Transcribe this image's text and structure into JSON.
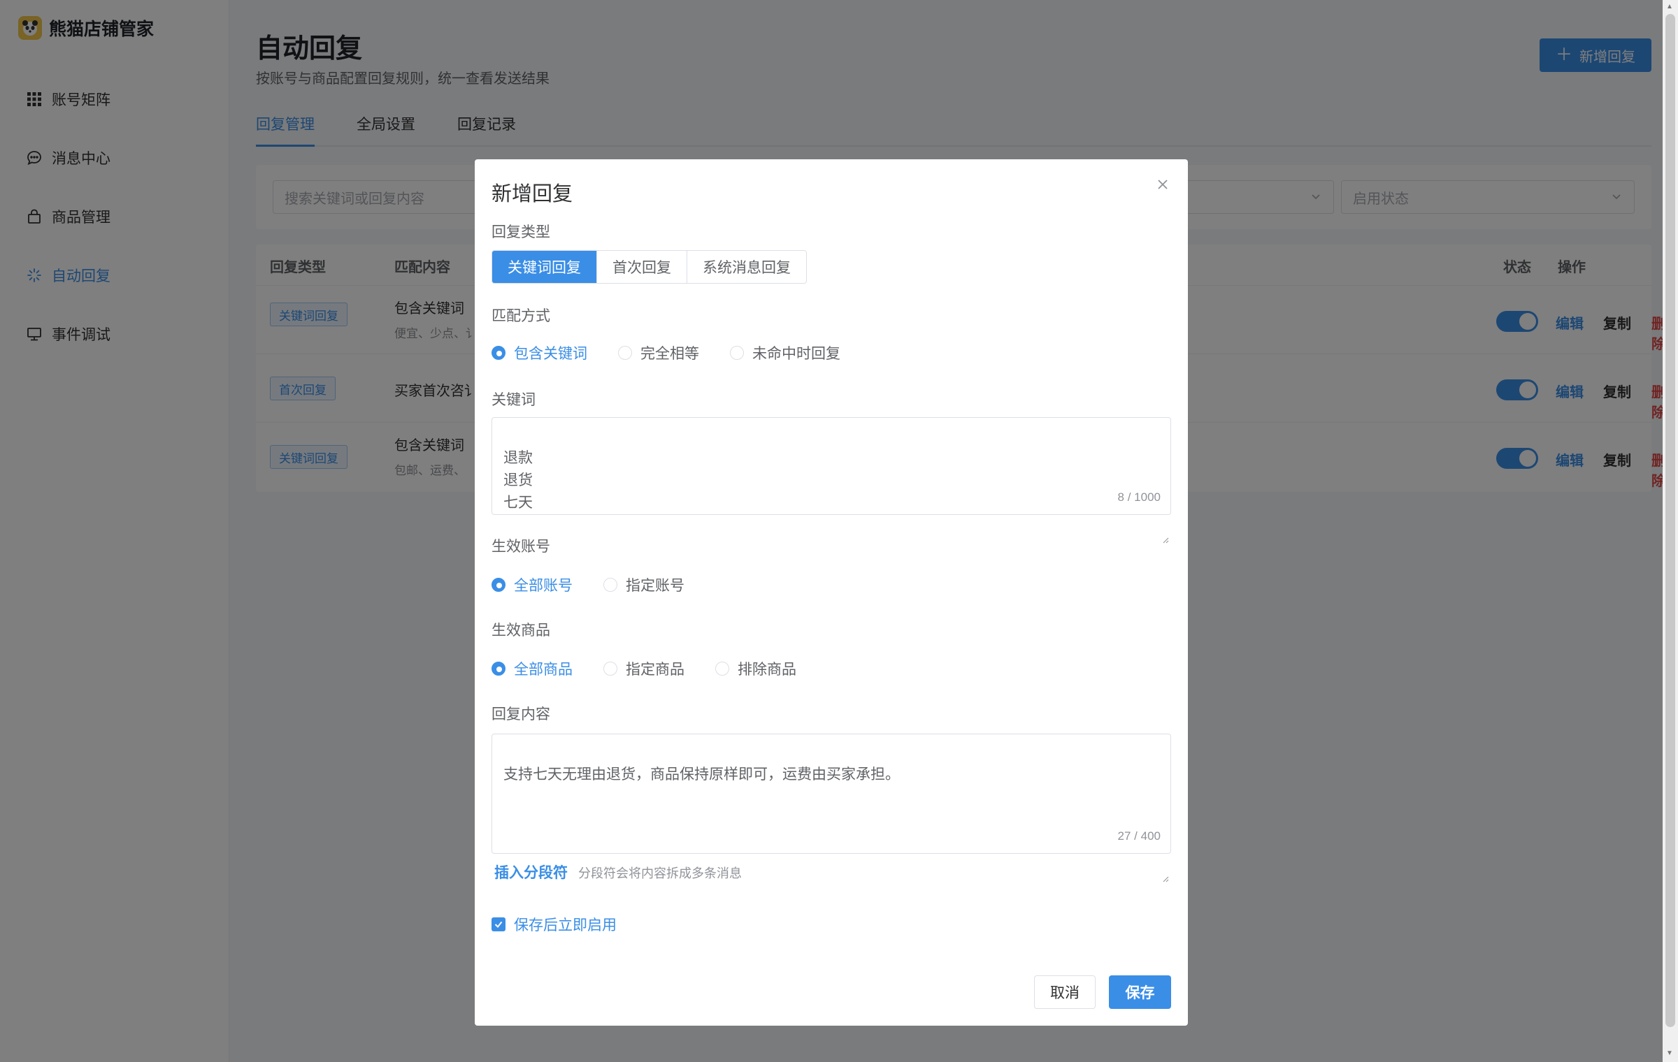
{
  "app": {
    "name": "熊猫店铺管家"
  },
  "sidebar": {
    "items": [
      {
        "label": "账号矩阵",
        "icon": "grid-icon"
      },
      {
        "label": "消息中心",
        "icon": "chat-bubble-icon"
      },
      {
        "label": "商品管理",
        "icon": "shopping-bag-icon"
      },
      {
        "label": "自动回复",
        "icon": "sparkle-icon",
        "active": true
      },
      {
        "label": "事件调试",
        "icon": "monitor-icon"
      }
    ]
  },
  "page": {
    "title": "自动回复",
    "subtitle": "按账号与商品配置回复规则，统一查看发送结果",
    "new_button": "新增回复",
    "tabs": [
      "回复管理",
      "全局设置",
      "回复记录"
    ]
  },
  "filters": {
    "search_placeholder": "搜索关键词或回复内容",
    "status_placeholder": "启用状态"
  },
  "table": {
    "headers": {
      "type": "回复类型",
      "match": "匹配内容",
      "status": "状态",
      "ops": "操作"
    },
    "rows": [
      {
        "type": "关键词回复",
        "match": "包含关键词",
        "sub": "便宜、少点、讠",
        "enabled": true
      },
      {
        "type": "首次回复",
        "match": "买家首次咨讠",
        "sub": "",
        "enabled": true
      },
      {
        "type": "关键词回复",
        "match": "包含关键词",
        "sub": "包邮、运费、",
        "enabled": true
      }
    ],
    "op_edit": "编辑",
    "op_copy": "复制",
    "op_delete": "删除"
  },
  "dialog": {
    "title": "新增回复",
    "reply_type_label": "回复类型",
    "reply_types": [
      "关键词回复",
      "首次回复",
      "系统消息回复"
    ],
    "match_mode_label": "匹配方式",
    "match_modes": [
      "包含关键词",
      "完全相等",
      "未命中时回复"
    ],
    "keywords_label": "关键词",
    "keywords_value": "退款\n退货\n七天",
    "keywords_counter": "8 / 1000",
    "account_label": "生效账号",
    "account_options": [
      "全部账号",
      "指定账号"
    ],
    "product_label": "生效商品",
    "product_options": [
      "全部商品",
      "指定商品",
      "排除商品"
    ],
    "content_label": "回复内容",
    "content_value": "支持七天无理由退货，商品保持原样即可，运费由买家承担。",
    "content_counter": "27 / 400",
    "insert_link": "插入分段符",
    "insert_hint": "分段符会将内容拆成多条消息",
    "enable_checkbox": "保存后立即启用",
    "cancel": "取消",
    "save": "保存"
  },
  "colors": {
    "primary": "#3a8ee6",
    "danger": "#e04848",
    "overlay": "rgba(0,0,0,0.5)"
  }
}
